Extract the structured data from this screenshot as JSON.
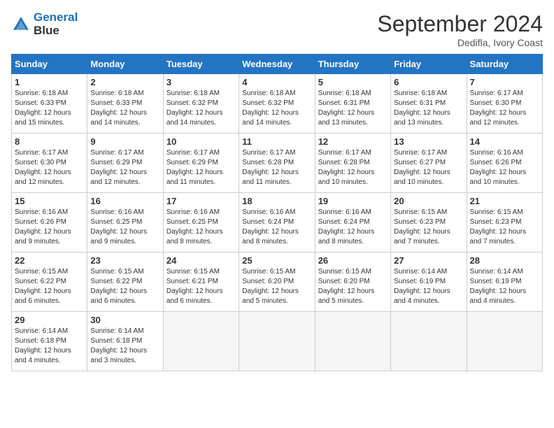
{
  "header": {
    "logo_line1": "General",
    "logo_line2": "Blue",
    "month_title": "September 2024",
    "location": "Dedifla, Ivory Coast"
  },
  "days_of_week": [
    "Sunday",
    "Monday",
    "Tuesday",
    "Wednesday",
    "Thursday",
    "Friday",
    "Saturday"
  ],
  "weeks": [
    [
      {
        "day": "1",
        "rise": "6:18 AM",
        "set": "6:33 PM",
        "hours": "12 hours and 15 minutes."
      },
      {
        "day": "2",
        "rise": "6:18 AM",
        "set": "6:33 PM",
        "hours": "12 hours and 14 minutes."
      },
      {
        "day": "3",
        "rise": "6:18 AM",
        "set": "6:32 PM",
        "hours": "12 hours and 14 minutes."
      },
      {
        "day": "4",
        "rise": "6:18 AM",
        "set": "6:32 PM",
        "hours": "12 hours and 14 minutes."
      },
      {
        "day": "5",
        "rise": "6:18 AM",
        "set": "6:31 PM",
        "hours": "12 hours and 13 minutes."
      },
      {
        "day": "6",
        "rise": "6:18 AM",
        "set": "6:31 PM",
        "hours": "12 hours and 13 minutes."
      },
      {
        "day": "7",
        "rise": "6:17 AM",
        "set": "6:30 PM",
        "hours": "12 hours and 12 minutes."
      }
    ],
    [
      {
        "day": "8",
        "rise": "6:17 AM",
        "set": "6:30 PM",
        "hours": "12 hours and 12 minutes."
      },
      {
        "day": "9",
        "rise": "6:17 AM",
        "set": "6:29 PM",
        "hours": "12 hours and 12 minutes."
      },
      {
        "day": "10",
        "rise": "6:17 AM",
        "set": "6:29 PM",
        "hours": "12 hours and 11 minutes."
      },
      {
        "day": "11",
        "rise": "6:17 AM",
        "set": "6:28 PM",
        "hours": "12 hours and 11 minutes."
      },
      {
        "day": "12",
        "rise": "6:17 AM",
        "set": "6:28 PM",
        "hours": "12 hours and 10 minutes."
      },
      {
        "day": "13",
        "rise": "6:17 AM",
        "set": "6:27 PM",
        "hours": "12 hours and 10 minutes."
      },
      {
        "day": "14",
        "rise": "6:16 AM",
        "set": "6:26 PM",
        "hours": "12 hours and 10 minutes."
      }
    ],
    [
      {
        "day": "15",
        "rise": "6:16 AM",
        "set": "6:26 PM",
        "hours": "12 hours and 9 minutes."
      },
      {
        "day": "16",
        "rise": "6:16 AM",
        "set": "6:25 PM",
        "hours": "12 hours and 9 minutes."
      },
      {
        "day": "17",
        "rise": "6:16 AM",
        "set": "6:25 PM",
        "hours": "12 hours and 8 minutes."
      },
      {
        "day": "18",
        "rise": "6:16 AM",
        "set": "6:24 PM",
        "hours": "12 hours and 8 minutes."
      },
      {
        "day": "19",
        "rise": "6:16 AM",
        "set": "6:24 PM",
        "hours": "12 hours and 8 minutes."
      },
      {
        "day": "20",
        "rise": "6:15 AM",
        "set": "6:23 PM",
        "hours": "12 hours and 7 minutes."
      },
      {
        "day": "21",
        "rise": "6:15 AM",
        "set": "6:23 PM",
        "hours": "12 hours and 7 minutes."
      }
    ],
    [
      {
        "day": "22",
        "rise": "6:15 AM",
        "set": "6:22 PM",
        "hours": "12 hours and 6 minutes."
      },
      {
        "day": "23",
        "rise": "6:15 AM",
        "set": "6:22 PM",
        "hours": "12 hours and 6 minutes."
      },
      {
        "day": "24",
        "rise": "6:15 AM",
        "set": "6:21 PM",
        "hours": "12 hours and 6 minutes."
      },
      {
        "day": "25",
        "rise": "6:15 AM",
        "set": "6:20 PM",
        "hours": "12 hours and 5 minutes."
      },
      {
        "day": "26",
        "rise": "6:15 AM",
        "set": "6:20 PM",
        "hours": "12 hours and 5 minutes."
      },
      {
        "day": "27",
        "rise": "6:14 AM",
        "set": "6:19 PM",
        "hours": "12 hours and 4 minutes."
      },
      {
        "day": "28",
        "rise": "6:14 AM",
        "set": "6:19 PM",
        "hours": "12 hours and 4 minutes."
      }
    ],
    [
      {
        "day": "29",
        "rise": "6:14 AM",
        "set": "6:18 PM",
        "hours": "12 hours and 4 minutes."
      },
      {
        "day": "30",
        "rise": "6:14 AM",
        "set": "6:18 PM",
        "hours": "12 hours and 3 minutes."
      },
      null,
      null,
      null,
      null,
      null
    ]
  ]
}
